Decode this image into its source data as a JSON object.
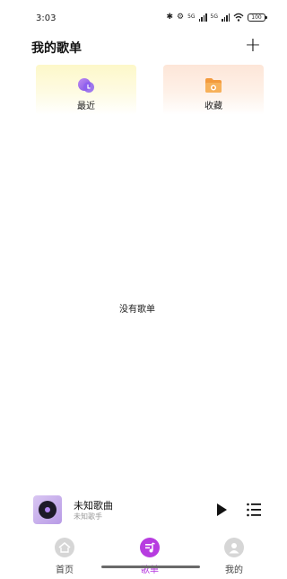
{
  "status_bar": {
    "time": "3:03",
    "network_label_1": "5G",
    "network_label_2": "5G",
    "battery": "100"
  },
  "header": {
    "title": "我的歌单",
    "add_label": "+"
  },
  "quick_cards": [
    {
      "label": "最近",
      "icon": "recent-icon"
    },
    {
      "label": "收藏",
      "icon": "favorites-folder-icon"
    }
  ],
  "empty_state": {
    "message": "没有歌单"
  },
  "mini_player": {
    "song_title": "未知歌曲",
    "artist": "未知歌手",
    "play_icon": "play-icon",
    "playlist_icon": "playlist-icon"
  },
  "bottom_nav": {
    "items": [
      {
        "label": "首页",
        "icon": "home-icon",
        "active": false
      },
      {
        "label": "歌单",
        "icon": "playlist-icon",
        "active": true
      },
      {
        "label": "我的",
        "icon": "profile-icon",
        "active": false
      }
    ]
  },
  "colors": {
    "accent": "#b73ce0",
    "recent_card": "#fdf8c9",
    "favorite_card": "#fde6d8"
  }
}
